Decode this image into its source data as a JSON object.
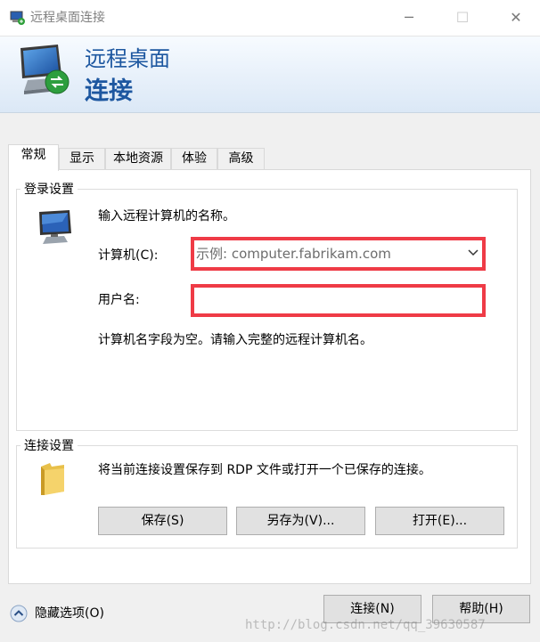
{
  "window": {
    "title": "远程桌面连接",
    "controls": {
      "minimize": "─",
      "maximize": "☐",
      "close": "✕"
    }
  },
  "banner": {
    "line1": "远程桌面",
    "line2": "连接"
  },
  "tabs": [
    {
      "label": "常规",
      "active": true
    },
    {
      "label": "显示"
    },
    {
      "label": "本地资源"
    },
    {
      "label": "体验"
    },
    {
      "label": "高级"
    }
  ],
  "login_settings": {
    "title": "登录设置",
    "prompt": "输入远程计算机的名称。",
    "computer_label": "计算机(C):",
    "computer_placeholder": "示例: computer.fabrikam.com",
    "username_label": "用户名:",
    "username_value": "",
    "empty_message": "计算机名字段为空。请输入完整的远程计算机名。"
  },
  "connection_settings": {
    "title": "连接设置",
    "description": "将当前连接设置保存到 RDP 文件或打开一个已保存的连接。",
    "save": "保存(S)",
    "save_as": "另存为(V)...",
    "open": "打开(E)..."
  },
  "footer": {
    "hide_options": "隐藏选项(O)",
    "connect": "连接(N)",
    "help": "帮助(H)"
  },
  "watermark": "http://blog.csdn.net/qq_39630587",
  "colors": {
    "highlight": "#ef3b46",
    "banner_text": "#1d57a0"
  },
  "icons": {
    "app": "remote-desktop-icon",
    "banner": "remote-desktop-icon",
    "computer": "computer-icon",
    "folder": "folder-icon",
    "hide": "chevron-up-icon",
    "combo": "chevron-down-icon"
  }
}
